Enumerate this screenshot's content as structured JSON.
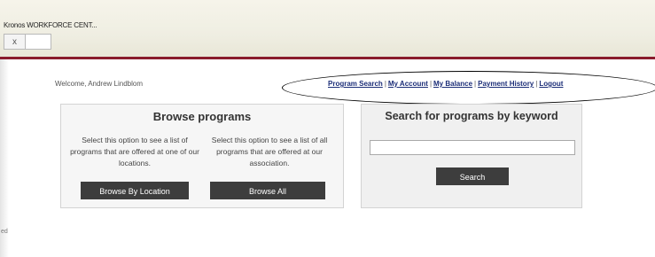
{
  "window": {
    "title": "Kronos WORKFORCE CENT...",
    "close_glyph": "x"
  },
  "header": {
    "welcome": "Welcome, Andrew Lindblom",
    "nav": [
      {
        "label": "Program Search"
      },
      {
        "label": "My Account"
      },
      {
        "label": "My Balance"
      },
      {
        "label": "Payment History"
      },
      {
        "label": "Logout"
      }
    ],
    "separator": "|"
  },
  "browse": {
    "title": "Browse programs",
    "location_desc": "Select this option to see a list of programs that are offered at one of our locations.",
    "all_desc": "Select this option to see a list of all programs that are offered at our association.",
    "location_button": "Browse By Location",
    "all_button": "Browse All"
  },
  "search": {
    "title": "Search for programs by keyword",
    "input_value": "",
    "button": "Search"
  },
  "edge_fragment": "ed",
  "colors": {
    "accent": "#8a1c2c",
    "link": "#1c2e78",
    "button_bg": "#3d3d3d"
  }
}
